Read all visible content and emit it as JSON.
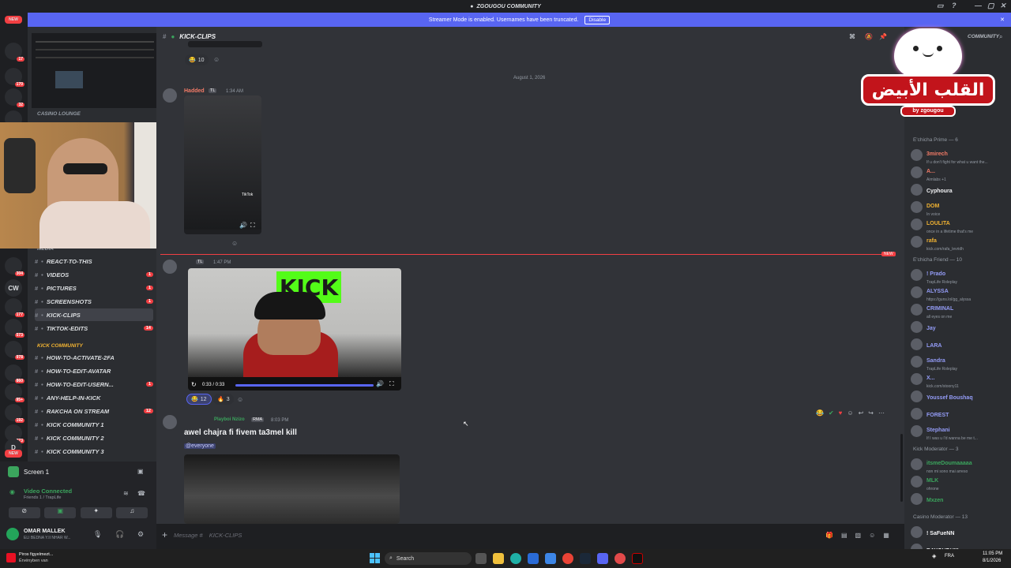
{
  "window": {
    "title": "ZGOUGOU COMMUNITY"
  },
  "banner": {
    "text": "Streamer Mode is enabled. Usernames have been truncated.",
    "button": "Disable"
  },
  "rail": {
    "new_top": "NEW",
    "new_bottom": "NEW",
    "items": [
      {
        "label": "",
        "badge": "17"
      },
      {
        "label": "",
        "badge": "170"
      },
      {
        "label": "",
        "badge": "32"
      },
      {
        "label": "",
        "badge": "1"
      },
      {
        "label": "",
        "badge": "304"
      },
      {
        "label": "CW",
        "badge": ""
      },
      {
        "label": "",
        "badge": "177"
      },
      {
        "label": "",
        "badge": "573"
      },
      {
        "label": "",
        "badge": "978"
      },
      {
        "label": "",
        "badge": "860"
      },
      {
        "label": "",
        "badge": "95+"
      },
      {
        "label": "",
        "badge": "192"
      },
      {
        "label": "",
        "badge": "373"
      },
      {
        "label": "D",
        "badge": ""
      }
    ]
  },
  "sidebar": {
    "category_top": "CASINO LOUNGE",
    "category_media": "MEDIA",
    "channels": [
      {
        "name": "REACT-TO-THIS",
        "badge": ""
      },
      {
        "name": "VIDEOS",
        "badge": "1"
      },
      {
        "name": "PICTURES",
        "badge": "1"
      },
      {
        "name": "SCREENSHOTS",
        "badge": "1"
      },
      {
        "name": "KICK-CLIPS",
        "badge": ""
      },
      {
        "name": "TIKTOK-EDITS",
        "badge": "14"
      }
    ],
    "category_kick": "KICK COMMUNITY",
    "kick_channels": [
      {
        "name": "HOW-TO-ACTIVATE-2FA",
        "badge": ""
      },
      {
        "name": "HOW-TO-EDIT-AVATAR",
        "badge": ""
      },
      {
        "name": "HOW-TO-EDIT-USERN...",
        "badge": "1"
      },
      {
        "name": "ANY-HELP-IN-KICK",
        "badge": ""
      },
      {
        "name": "RAKCHA ON STREAM",
        "badge": "12"
      },
      {
        "name": "KICK COMMUNITY 1",
        "badge": ""
      },
      {
        "name": "KICK COMMUNITY 2",
        "badge": ""
      },
      {
        "name": "KICK COMMUNITY 3",
        "badge": ""
      }
    ]
  },
  "panel": {
    "screen_label": "Screen 1",
    "voice_status": "Video Connected",
    "voice_sub": "Friends 1 / TrapLife",
    "user_name": "OMAR MALLEK",
    "user_status": "ELI BEDNA Y.II NHAR W..."
  },
  "chat": {
    "channel": "KICK-CLIPS",
    "date_divider": "August 1, 2026",
    "new_label": "NEW",
    "msg1": {
      "author": "Hadded",
      "tag": "TL",
      "time": "1:34 AM",
      "react_count": "10",
      "video_watermark": "TikTok"
    },
    "msg2": {
      "tag": "TL",
      "time": "1:47 PM",
      "video_time": "0:33 / 0:33",
      "video_text": "KICK",
      "reactions": [
        {
          "emoji": "😂",
          "count": "12"
        },
        {
          "emoji": "🔥",
          "count": "3"
        }
      ]
    },
    "msg3": {
      "author": "Playboi Nzizo",
      "tag": "RMA",
      "time": "8:03 PM",
      "text": "awel chajra fi fivem ta3mel kill",
      "mention": "@everyone"
    },
    "input_placeholder": "Message #",
    "input_channel": "KICK-CLIPS"
  },
  "members": {
    "server_title": "COMMUNITY",
    "groups": [
      {
        "label": "E'chicha Prime — 6",
        "items": [
          {
            "name": "3mirech",
            "status": "If u don't fight for what u want the...",
            "color": "#f47b67"
          },
          {
            "name": "A...",
            "status": "Aimlabs +1",
            "color": "#f47b67"
          },
          {
            "name": "Cyphoura",
            "status": "",
            "color": "#f2f3f5"
          },
          {
            "name": "DOM",
            "status": "In voice",
            "color": "#f0b232"
          },
          {
            "name": "LOULITA",
            "status": "once in a lifetime that's me",
            "color": "#f0b232"
          },
          {
            "name": "rafa",
            "status": "kick.com/rafa_levridh",
            "color": "#f0b232"
          }
        ]
      },
      {
        "label": "E'chicha Friend — 10",
        "items": [
          {
            "name": "! Prado",
            "status": "TrapLife Roleplay",
            "color": "#949cf7"
          },
          {
            "name": "ALYSSA",
            "status": "https://guns.lol/gg_alyssa",
            "color": "#949cf7"
          },
          {
            "name": "CRIMINAL",
            "status": "all eyes on me",
            "color": "#949cf7"
          },
          {
            "name": "Jay",
            "status": "",
            "color": "#949cf7"
          },
          {
            "name": "LARA",
            "status": "",
            "color": "#949cf7"
          },
          {
            "name": "Sandra",
            "status": "TrapLife Roleplay",
            "color": "#949cf7"
          },
          {
            "name": "X...",
            "status": "kick.com/stoony11",
            "color": "#949cf7"
          },
          {
            "name": "Youssef Boushaq",
            "status": "",
            "color": "#949cf7"
          },
          {
            "name": "FOREST",
            "status": "",
            "color": "#949cf7"
          },
          {
            "name": "Stephani",
            "status": "If I was u I'd wanna be me t...",
            "color": "#949cf7"
          }
        ]
      },
      {
        "label": "Kick Moderator — 3",
        "items": [
          {
            "name": "itsmeDoumaaaaa",
            "status": "non mi sono mai arreso",
            "color": "#3ba55d"
          },
          {
            "name": "MLK",
            "status": "ohrone",
            "color": "#3ba55d"
          },
          {
            "name": "Mxzen",
            "status": "",
            "color": "#3ba55d"
          }
        ]
      },
      {
        "label": "Casino Moderator — 13",
        "items": [
          {
            "name": "! SaFueNN",
            "status": "",
            "color": "#f2f3f5"
          },
          {
            "name": "BAYOUDHIII",
            "status": "",
            "color": "#f2f3f5"
          }
        ]
      }
    ]
  },
  "overlay": {
    "arabic": "القلب الأبيض",
    "byline": "by zgougou"
  },
  "taskbar": {
    "notif_title": "Piros figyelmezt...",
    "notif_sub": "Érvényben van",
    "search": "Search",
    "lang": "FRA",
    "time": "11:05 PM",
    "date": "8/1/2026"
  },
  "colors": {
    "accent": "#5865f2",
    "danger": "#f23f43",
    "bg_chat": "#313338",
    "kick_green": "#53fc18"
  }
}
